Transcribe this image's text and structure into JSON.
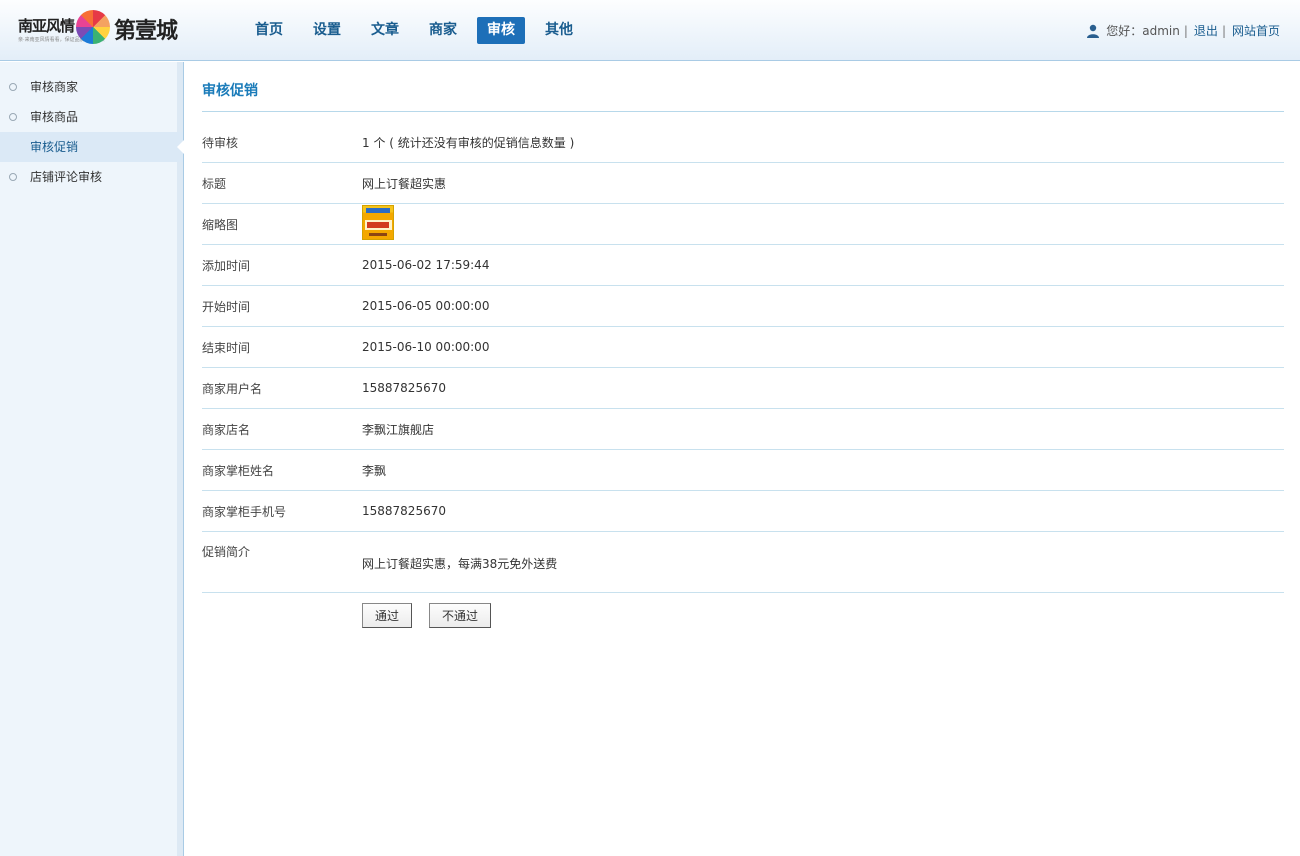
{
  "logo": {
    "left_text": "南亚风情",
    "tagline": "亲·来南亚风情看看，保证品质好逛起来",
    "right_text": "第壹城"
  },
  "nav": {
    "items": [
      "首页",
      "设置",
      "文章",
      "商家",
      "审核",
      "其他"
    ],
    "active": "审核"
  },
  "user": {
    "greeting": "您好：admin",
    "logout": "退出",
    "home_link": "网站首页",
    "separator": "|"
  },
  "sidebar": {
    "items": [
      "审核商家",
      "审核商品",
      "审核促销",
      "店铺评论审核"
    ],
    "active": "审核促销"
  },
  "main": {
    "title": "审核促销",
    "rows": [
      {
        "label": "待审核",
        "value": "1 个 ( 统计还没有审核的促销信息数量 )"
      },
      {
        "label": "标题",
        "value": "网上订餐超实惠"
      },
      {
        "label": "缩略图",
        "value": ""
      },
      {
        "label": "添加时间",
        "value": "2015-06-02 17:59:44"
      },
      {
        "label": "开始时间",
        "value": "2015-06-05 00:00:00"
      },
      {
        "label": "结束时间",
        "value": "2015-06-10 00:00:00"
      },
      {
        "label": "商家用户名",
        "value": "15887825670"
      },
      {
        "label": "商家店名",
        "value": "李飘江旗舰店"
      },
      {
        "label": "商家掌柜姓名",
        "value": "李飘"
      },
      {
        "label": "商家掌柜手机号",
        "value": "15887825670"
      },
      {
        "label": "促销简介",
        "value": "网上订餐超实惠，每满38元免外送费"
      }
    ],
    "approve_label": "通过",
    "reject_label": "不通过"
  },
  "colors": {
    "accent": "#1d6fb8",
    "title": "#1a7bb9",
    "nav_text": "#1a5d8f",
    "divider": "#c8e1ee"
  }
}
